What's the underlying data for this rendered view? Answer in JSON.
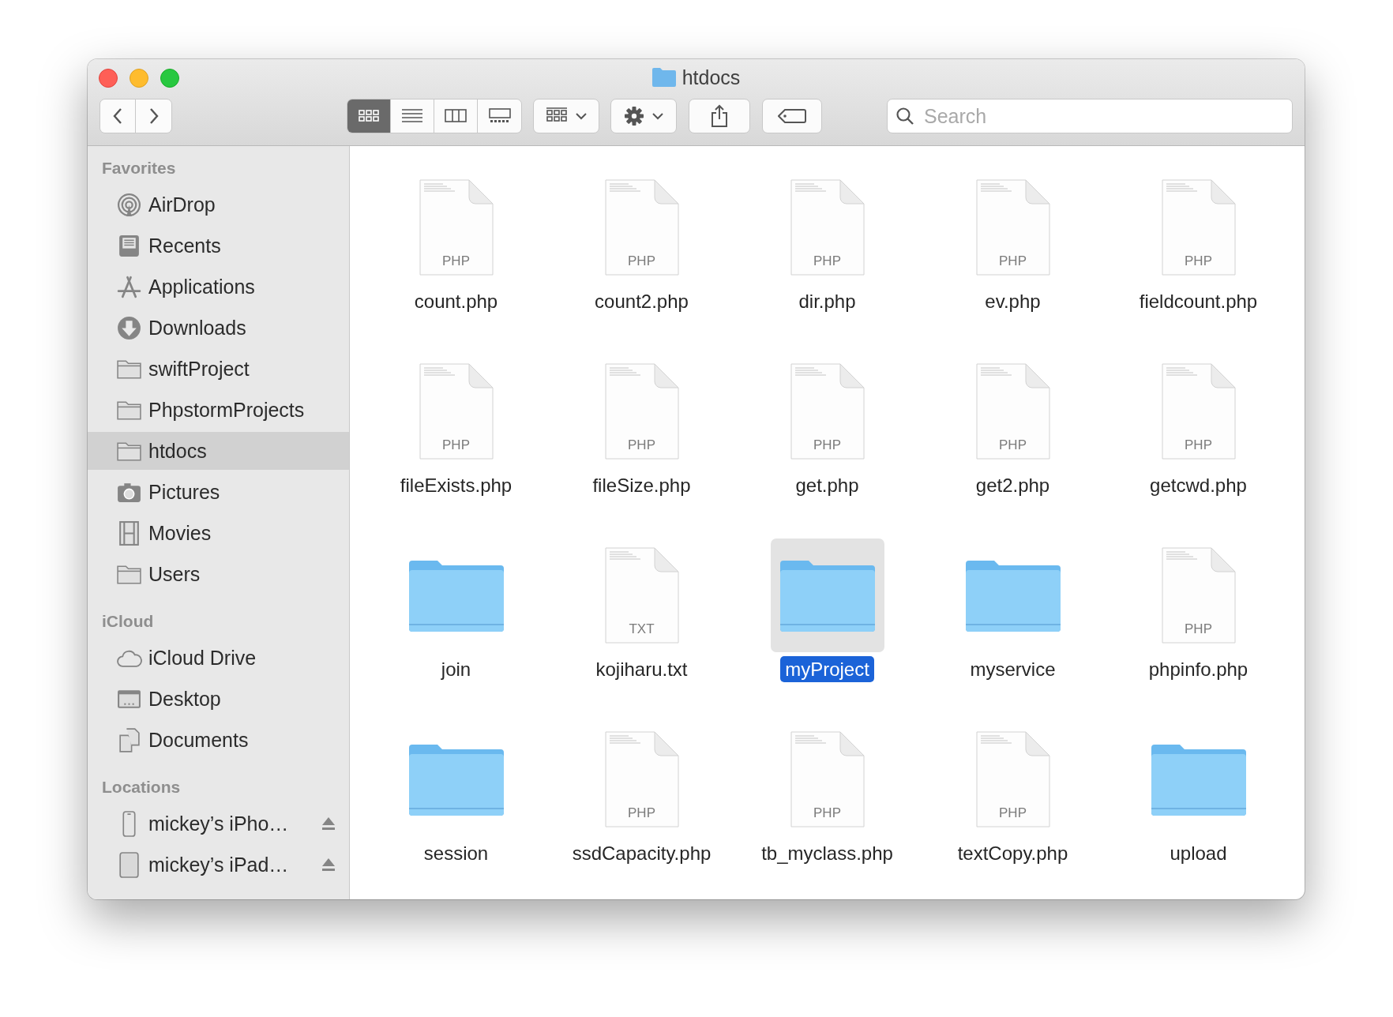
{
  "window": {
    "title": "htdocs"
  },
  "toolbar": {
    "view_modes": [
      {
        "kind": "icons",
        "selected": true
      },
      {
        "kind": "list",
        "selected": false
      },
      {
        "kind": "columns",
        "selected": false
      },
      {
        "kind": "gallery",
        "selected": false
      }
    ],
    "search": {
      "placeholder": "Search"
    }
  },
  "sidebar": {
    "sections": [
      {
        "title": "Favorites",
        "items": [
          {
            "label": "AirDrop",
            "kind": "airdrop",
            "selected": false
          },
          {
            "label": "Recents",
            "kind": "recents",
            "selected": false
          },
          {
            "label": "Applications",
            "kind": "applications",
            "selected": false
          },
          {
            "label": "Downloads",
            "kind": "downloads",
            "selected": false
          },
          {
            "label": "swiftProject",
            "kind": "folder",
            "selected": false
          },
          {
            "label": "PhpstormProjects",
            "kind": "folder",
            "selected": false
          },
          {
            "label": "htdocs",
            "kind": "folder",
            "selected": true
          },
          {
            "label": "Pictures",
            "kind": "pictures",
            "selected": false
          },
          {
            "label": "Movies",
            "kind": "movies",
            "selected": false
          },
          {
            "label": "Users",
            "kind": "folder",
            "selected": false
          }
        ]
      },
      {
        "title": "iCloud",
        "items": [
          {
            "label": "iCloud Drive",
            "kind": "cloud",
            "selected": false
          },
          {
            "label": "Desktop",
            "kind": "desktop",
            "selected": false
          },
          {
            "label": "Documents",
            "kind": "documents",
            "selected": false
          }
        ]
      },
      {
        "title": "Locations",
        "items": [
          {
            "label": "mickey’s iPho…",
            "kind": "iphone",
            "selected": false,
            "eject": true
          },
          {
            "label": "mickey’s iPad…",
            "kind": "ipad",
            "selected": false,
            "eject": true
          }
        ]
      }
    ]
  },
  "files": [
    {
      "name": "count.php",
      "kind": "document",
      "badge": "PHP",
      "selected": false
    },
    {
      "name": "count2.php",
      "kind": "document",
      "badge": "PHP",
      "selected": false
    },
    {
      "name": "dir.php",
      "kind": "document",
      "badge": "PHP",
      "selected": false
    },
    {
      "name": "ev.php",
      "kind": "document",
      "badge": "PHP",
      "selected": false
    },
    {
      "name": "fieldcount.php",
      "kind": "document",
      "badge": "PHP",
      "selected": false
    },
    {
      "name": "fileExists.php",
      "kind": "document",
      "badge": "PHP",
      "selected": false
    },
    {
      "name": "fileSize.php",
      "kind": "document",
      "badge": "PHP",
      "selected": false
    },
    {
      "name": "get.php",
      "kind": "document",
      "badge": "PHP",
      "selected": false
    },
    {
      "name": "get2.php",
      "kind": "document",
      "badge": "PHP",
      "selected": false
    },
    {
      "name": "getcwd.php",
      "kind": "document",
      "badge": "PHP",
      "selected": false
    },
    {
      "name": "join",
      "kind": "folder",
      "selected": false
    },
    {
      "name": "kojiharu.txt",
      "kind": "document",
      "badge": "TXT",
      "selected": false
    },
    {
      "name": "myProject",
      "kind": "folder",
      "selected": true
    },
    {
      "name": "myservice",
      "kind": "folder",
      "selected": false
    },
    {
      "name": "phpinfo.php",
      "kind": "document",
      "badge": "PHP",
      "selected": false
    },
    {
      "name": "session",
      "kind": "folder",
      "selected": false
    },
    {
      "name": "ssdCapacity.php",
      "kind": "document",
      "badge": "PHP",
      "selected": false
    },
    {
      "name": "tb_myclass.php",
      "kind": "document",
      "badge": "PHP",
      "selected": false
    },
    {
      "name": "textCopy.php",
      "kind": "document",
      "badge": "PHP",
      "selected": false
    },
    {
      "name": "upload",
      "kind": "folder",
      "selected": false
    }
  ]
}
